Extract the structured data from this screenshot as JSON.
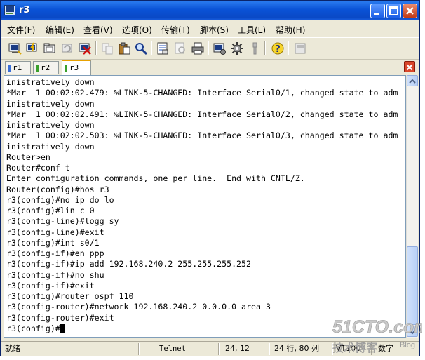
{
  "window": {
    "title": "r3"
  },
  "menu": [
    {
      "label": "文件(F)"
    },
    {
      "label": "编辑(E)"
    },
    {
      "label": "查看(V)"
    },
    {
      "label": "选项(O)"
    },
    {
      "label": "传输(T)"
    },
    {
      "label": "脚本(S)"
    },
    {
      "label": "工具(L)"
    },
    {
      "label": "帮助(H)"
    }
  ],
  "toolbar": [
    {
      "icon": "connect-icon"
    },
    {
      "icon": "quick-connect-icon"
    },
    {
      "icon": "connect-in-tab-icon"
    },
    {
      "icon": "reconnect-icon"
    },
    {
      "icon": "disconnect-icon"
    },
    {
      "icon": "copy-icon"
    },
    {
      "icon": "paste-icon"
    },
    {
      "icon": "find-icon"
    },
    {
      "icon": "print-setup-icon"
    },
    {
      "icon": "print-preview-icon"
    },
    {
      "icon": "print-icon"
    },
    {
      "icon": "session-options-icon"
    },
    {
      "icon": "global-options-icon"
    },
    {
      "icon": "keymap-icon"
    },
    {
      "icon": "help-icon"
    },
    {
      "icon": "sftp-icon"
    }
  ],
  "tabs": [
    {
      "label": "r1",
      "color": "#3b6fd6"
    },
    {
      "label": "r2",
      "color": "#3aa02c"
    },
    {
      "label": "r3",
      "color": "#3aa02c",
      "active": true
    }
  ],
  "terminal": {
    "lines": [
      "inistratively down",
      "*Mar  1 00:02:02.479: %LINK-5-CHANGED: Interface Serial0/1, changed state to adm",
      "inistratively down",
      "*Mar  1 00:02:02.491: %LINK-5-CHANGED: Interface Serial0/2, changed state to adm",
      "inistratively down",
      "*Mar  1 00:02:02.503: %LINK-5-CHANGED: Interface Serial0/3, changed state to adm",
      "inistratively down",
      "Router>en",
      "Router#conf t",
      "Enter configuration commands, one per line.  End with CNTL/Z.",
      "Router(config)#hos r3",
      "r3(config)#no ip do lo",
      "r3(config)#lin c 0",
      "r3(config-line)#logg sy",
      "r3(config-line)#exit",
      "r3(config)#int s0/1",
      "r3(config-if)#en ppp",
      "r3(config-if)#ip add 192.168.240.2 255.255.255.252",
      "r3(config-if)#no shu",
      "r3(config-if)#exit",
      "r3(config)#router ospf 110",
      "r3(config-router)#network 192.168.240.2 0.0.0.0 area 3",
      "r3(config-router)#exit",
      "r3(config)#"
    ]
  },
  "status": {
    "ready": "就绪",
    "protocol": "Telnet",
    "position": "24, 12",
    "size": "24 行, 80 列",
    "mode": "VT100",
    "numlock": "数字"
  },
  "watermark": {
    "brand": "51CTO.com",
    "sub": "技术博客",
    "blog": "Blog"
  }
}
